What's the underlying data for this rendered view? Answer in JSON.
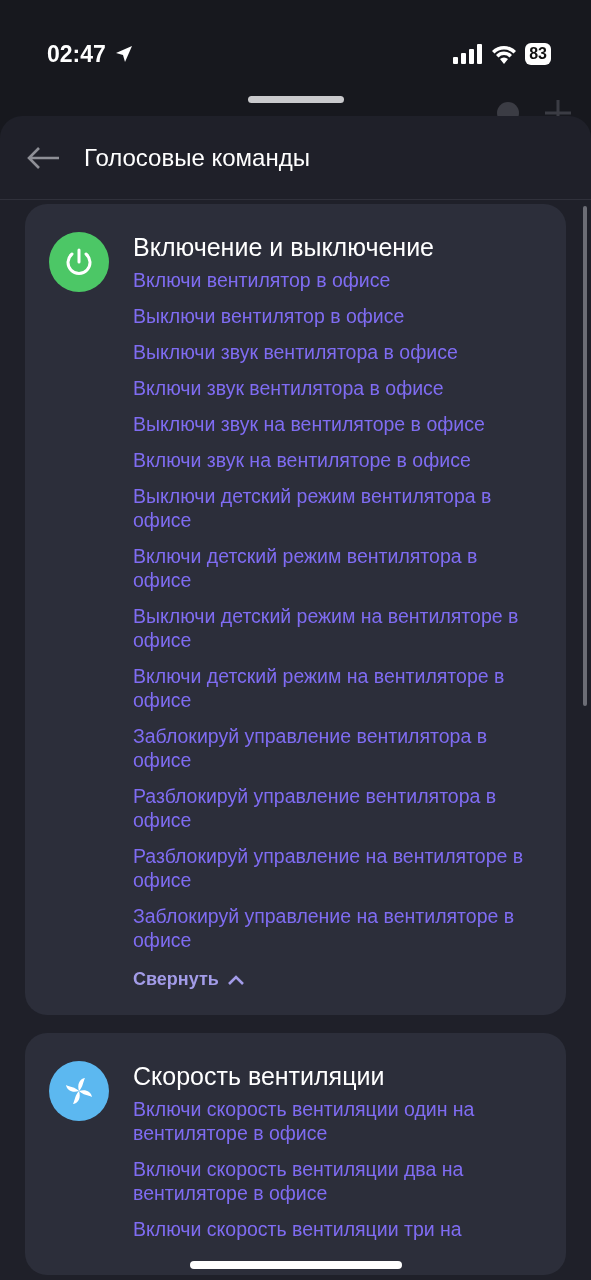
{
  "status_bar": {
    "time": "02:47",
    "battery": "83"
  },
  "sheet": {
    "title": "Голосовые команды"
  },
  "sections": [
    {
      "kind": "power",
      "title": "Включение и выключение",
      "commands": [
        "Включи вентилятор в офисе",
        "Выключи вентилятор в офисе",
        "Выключи звук вентилятора в офисе",
        "Включи звук вентилятора в офисе",
        "Выключи звук на вентиляторе в офисе",
        "Включи звук на вентиляторе в офисе",
        "Выключи детский режим вентилятора в офисе",
        "Включи детский режим вентилятора в офисе",
        "Выключи детский режим на вентиляторе в офисе",
        "Включи детский режим на вентиляторе в офисе",
        "Заблокируй управление вентилятора в офисе",
        "Разблокируй управление вентилятора в офисе",
        "Разблокируй управление на вентиляторе в офисе",
        "Заблокируй управление на вентиляторе в офисе"
      ],
      "toggle": "Свернуть",
      "expanded": true
    },
    {
      "kind": "fan",
      "title": "Скорость вентиляции",
      "commands": [
        "Включи скорость вентиляции один на вентиляторе в офисе",
        "Включи скорость вентиляции два на вентиляторе в офисе",
        "Включи скорость вентиляции три на"
      ]
    }
  ]
}
